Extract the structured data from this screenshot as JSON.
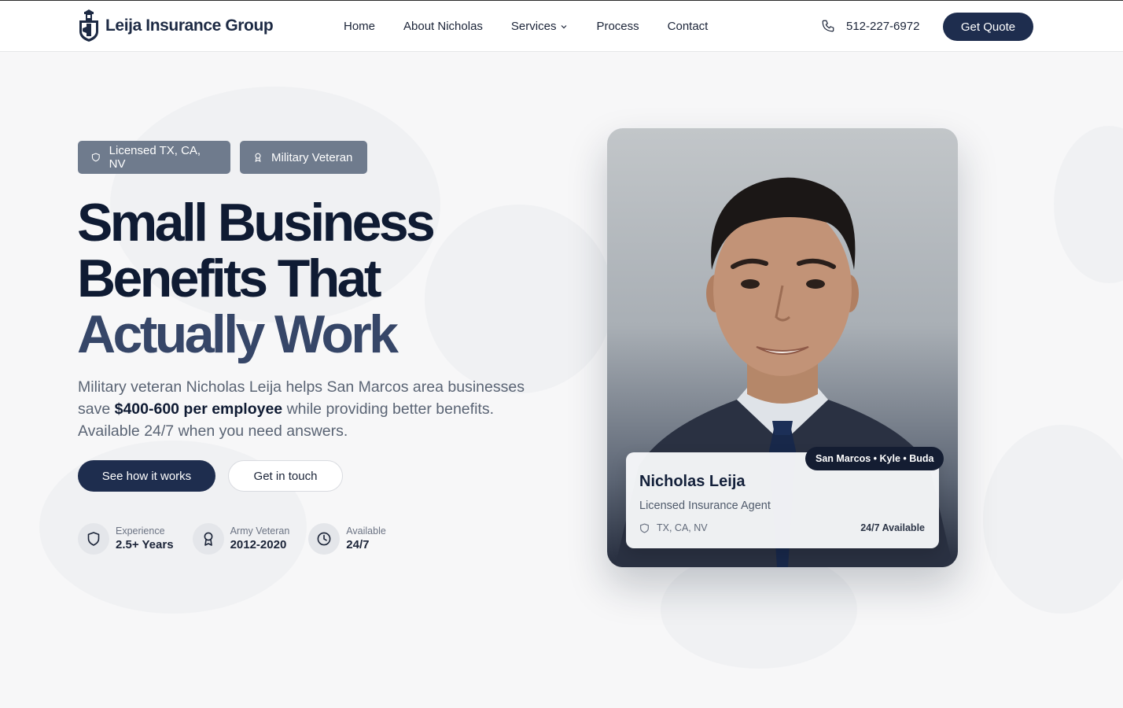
{
  "header": {
    "brand": "Leija Insurance Group",
    "nav": [
      {
        "label": "Home"
      },
      {
        "label": "About Nicholas"
      },
      {
        "label": "Services"
      },
      {
        "label": "Process"
      },
      {
        "label": "Contact"
      }
    ],
    "phone": "512-227-6972",
    "cta": "Get Quote"
  },
  "hero": {
    "badges": [
      "Licensed TX, CA, NV",
      "Military Veteran"
    ],
    "headline": [
      "Small Business",
      "Benefits That",
      "Actually Work"
    ],
    "lede_part1": "Military veteran Nicholas Leija helps San Marcos area businesses save ",
    "lede_bold": "$400-600 per employee",
    "lede_part2": " while providing better benefits. Available 24/7 when you need answers.",
    "primary_cta": "See how it works",
    "secondary_cta": "Get in touch",
    "stats": [
      {
        "label": "Experience",
        "value": "2.5+ Years",
        "icon": "shield-icon"
      },
      {
        "label": "Army Veteran",
        "value": "2012-2020",
        "icon": "award-icon"
      },
      {
        "label": "Available",
        "value": "24/7",
        "icon": "clock-icon"
      }
    ]
  },
  "agent_card": {
    "locations": "San Marcos • Kyle • Buda",
    "name": "Nicholas Leija",
    "role": "Licensed Insurance Agent",
    "states": "TX, CA, NV",
    "availability": "24/7 Available"
  },
  "colors": {
    "primary": "#1e2d4e",
    "badge": "#6f7b8d",
    "headline": "#0f1b33",
    "headline_accent": "#364668",
    "background": "#f7f7f8"
  }
}
